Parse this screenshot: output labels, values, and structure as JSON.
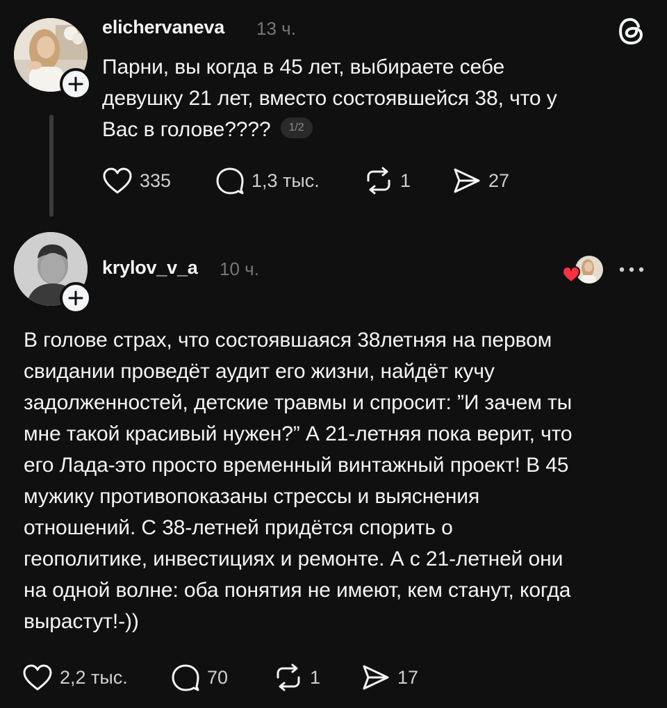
{
  "posts": [
    {
      "username": "elichervaneva",
      "time": "13 ч.",
      "text": "Парни, вы когда в 45 лет, выбираете себе\nдевушку 21 лет, вместо состоявшейся 38, что у\nВас в голове????",
      "page_indicator": "1/2",
      "actions": {
        "likes": "335",
        "replies": "1,3 тыс.",
        "reposts": "1",
        "shares": "27"
      }
    },
    {
      "username": "krylov_v_a",
      "time": "10 ч.",
      "text": "В голове страх, что состоявшаяся 38летняя на первом\nсвидании проведёт аудит его жизни, найдёт кучу\nзадолженностей, детские травмы и спросит: ”И зачем ты\nмне такой красивый нужен?” А 21-летняя пока верит, что\nего Лада-это просто временный винтажный проект! В 45\nмужику противопоказаны стрессы и выяснения\nотношений. С 38-летней придётся спорить о\nгеополитике, инвестициях и ремонте. А с 21-летней они\nна одной волне: оба понятия не имеют, кем станут, когда\nвырастут!-))",
      "actions": {
        "likes": "2,2 тыс.",
        "replies": "70",
        "reposts": "1",
        "shares": "17"
      }
    }
  ],
  "icons": {
    "app_logo": "threads-logo-icon",
    "follow": "plus-icon",
    "like": "heart-icon",
    "reply": "speech-bubble-icon",
    "repost": "repost-arrows-icon",
    "share": "paper-plane-icon",
    "more": "more-dots-icon",
    "liked_by_author": "red-heart-icon"
  },
  "colors": {
    "background": "#101010",
    "text": "#f3f5f7",
    "muted": "#777777",
    "liked_heart": "#ff3040"
  }
}
